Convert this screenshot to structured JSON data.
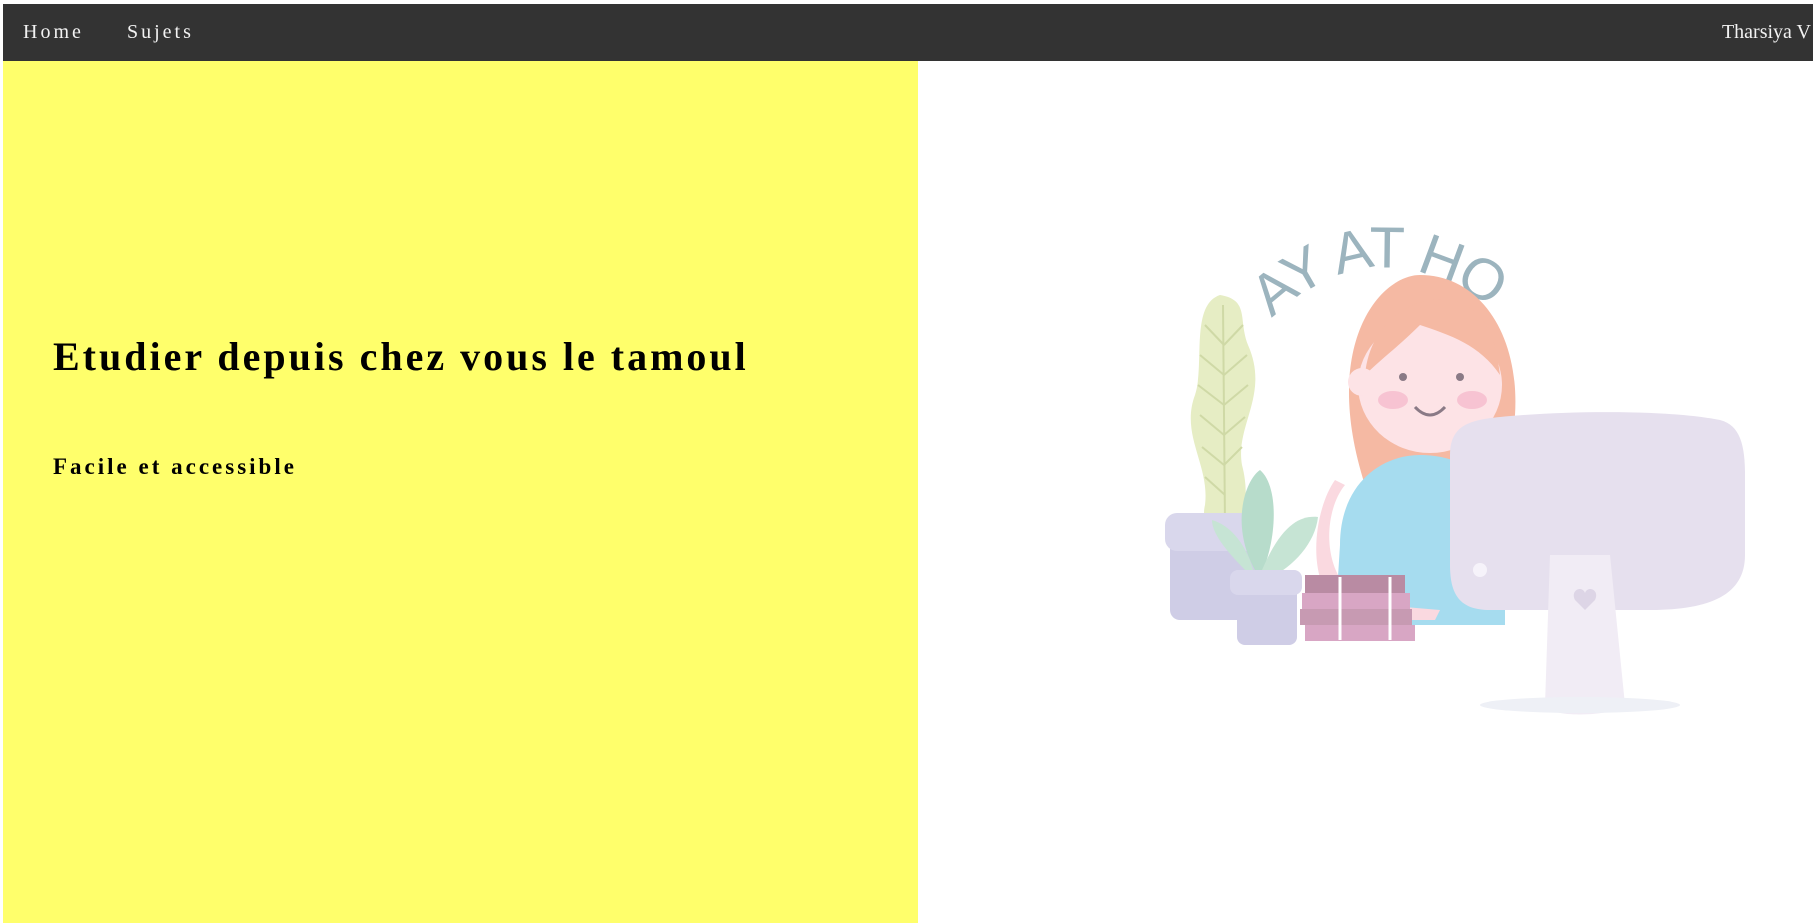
{
  "navbar": {
    "home_label": "Home",
    "sujets_label": "Sujets",
    "user_name": "Tharsiya V",
    "background": "#333333"
  },
  "hero": {
    "title": "Etudier depuis chez vous le tamoul",
    "subtitle": "Facile et accessible",
    "left_background": "#ffff6b"
  },
  "illustration": {
    "caption_text": "STAY AT HOME",
    "icon": "girl-at-computer-illustration"
  }
}
